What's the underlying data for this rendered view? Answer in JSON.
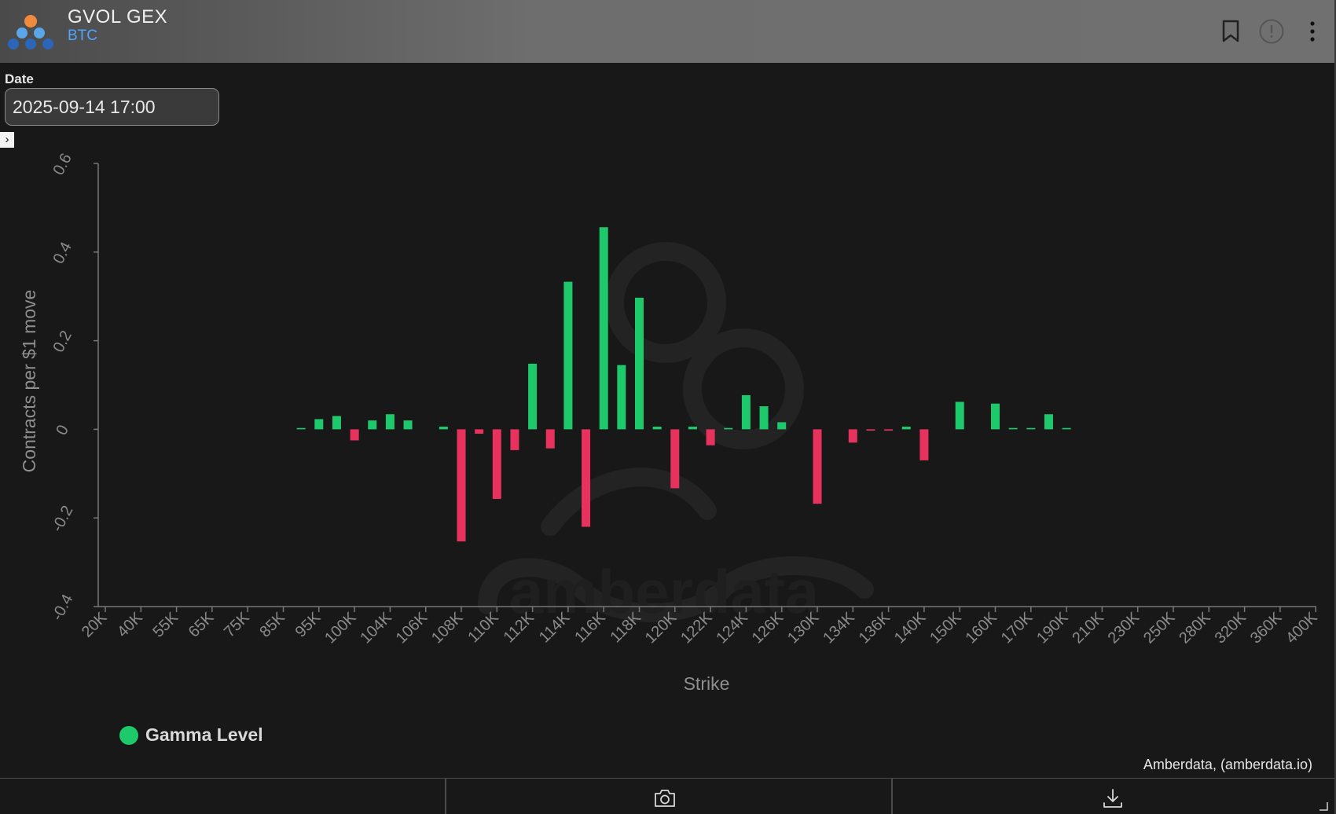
{
  "header": {
    "title": "GVOL GEX",
    "subtitle": "BTC",
    "icons": [
      "bookmark-icon",
      "alert-circle-icon",
      "more-vertical-icon"
    ]
  },
  "filters": {
    "date_label": "Date",
    "date_value": "2025-09-14 17:00"
  },
  "colors": {
    "positive": "#1ec96b",
    "negative": "#e8325e",
    "accent": "#4da6ff",
    "background": "#181818"
  },
  "watermark": "amberdata",
  "chart_data": {
    "type": "bar",
    "xlabel": "Strike",
    "ylabel": "Contracts per $1 move",
    "ylim": [
      -0.4,
      0.6
    ],
    "yticks": [
      "-0.4",
      "-0.2",
      "0",
      "0.2",
      "0.4",
      "0.6"
    ],
    "ytick_values": [
      -0.4,
      -0.2,
      0,
      0.2,
      0.4,
      0.6
    ],
    "categories": [
      "20K",
      "40K",
      "55K",
      "65K",
      "75K",
      "85K",
      "95K",
      "100K",
      "104K",
      "106K",
      "108K",
      "110K",
      "112K",
      "114K",
      "116K",
      "118K",
      "120K",
      "122K",
      "124K",
      "126K",
      "130K",
      "134K",
      "136K",
      "140K",
      "150K",
      "160K",
      "170K",
      "190K",
      "210K",
      "230K",
      "250K",
      "280K",
      "320K",
      "360K",
      "400K"
    ],
    "bars": [
      {
        "tick": 5,
        "offset": 0.5,
        "value": 0.003
      },
      {
        "tick": 6,
        "offset": 0.0,
        "value": 0.023
      },
      {
        "tick": 6,
        "offset": 0.5,
        "value": 0.03
      },
      {
        "tick": 7,
        "offset": 0.0,
        "value": -0.025
      },
      {
        "tick": 7,
        "offset": 0.5,
        "value": 0.02
      },
      {
        "tick": 8,
        "offset": 0.0,
        "value": 0.034
      },
      {
        "tick": 8,
        "offset": 0.5,
        "value": 0.02
      },
      {
        "tick": 9,
        "offset": 0.5,
        "value": 0.006
      },
      {
        "tick": 10,
        "offset": 0.0,
        "value": -0.253
      },
      {
        "tick": 10,
        "offset": 0.5,
        "value": -0.01
      },
      {
        "tick": 11,
        "offset": 0.0,
        "value": -0.157
      },
      {
        "tick": 11,
        "offset": 0.5,
        "value": -0.047
      },
      {
        "tick": 12,
        "offset": 0.0,
        "value": 0.148
      },
      {
        "tick": 12,
        "offset": 0.5,
        "value": -0.043
      },
      {
        "tick": 13,
        "offset": 0.0,
        "value": 0.333
      },
      {
        "tick": 13,
        "offset": 0.5,
        "value": -0.22
      },
      {
        "tick": 14,
        "offset": 0.0,
        "value": 0.456
      },
      {
        "tick": 14,
        "offset": 0.5,
        "value": 0.145
      },
      {
        "tick": 15,
        "offset": 0.0,
        "value": 0.297
      },
      {
        "tick": 15,
        "offset": 0.5,
        "value": 0.006
      },
      {
        "tick": 16,
        "offset": 0.0,
        "value": -0.133
      },
      {
        "tick": 16,
        "offset": 0.5,
        "value": 0.006
      },
      {
        "tick": 17,
        "offset": 0.0,
        "value": -0.036
      },
      {
        "tick": 17,
        "offset": 0.5,
        "value": 0.003
      },
      {
        "tick": 18,
        "offset": 0.0,
        "value": 0.077
      },
      {
        "tick": 18,
        "offset": 0.5,
        "value": 0.052
      },
      {
        "tick": 19,
        "offset": 0.0,
        "value": 0.016
      },
      {
        "tick": 20,
        "offset": 0.0,
        "value": -0.168
      },
      {
        "tick": 21,
        "offset": 0.0,
        "value": -0.03
      },
      {
        "tick": 21,
        "offset": 0.5,
        "value": -0.003
      },
      {
        "tick": 22,
        "offset": 0.0,
        "value": -0.003
      },
      {
        "tick": 22,
        "offset": 0.5,
        "value": 0.006
      },
      {
        "tick": 23,
        "offset": 0.0,
        "value": -0.07
      },
      {
        "tick": 24,
        "offset": 0.0,
        "value": 0.062
      },
      {
        "tick": 25,
        "offset": 0.0,
        "value": 0.058
      },
      {
        "tick": 25,
        "offset": 0.5,
        "value": 0.003
      },
      {
        "tick": 26,
        "offset": 0.0,
        "value": 0.003
      },
      {
        "tick": 26,
        "offset": 0.5,
        "value": 0.034
      },
      {
        "tick": 27,
        "offset": 0.0,
        "value": 0.003
      }
    ],
    "legend": [
      "Gamma Level"
    ],
    "legend_position": "bottom-left",
    "grid": false
  },
  "credit": "Amberdata, (amberdata.io)",
  "footer": {
    "icons": [
      "camera-icon",
      "download-icon"
    ]
  }
}
